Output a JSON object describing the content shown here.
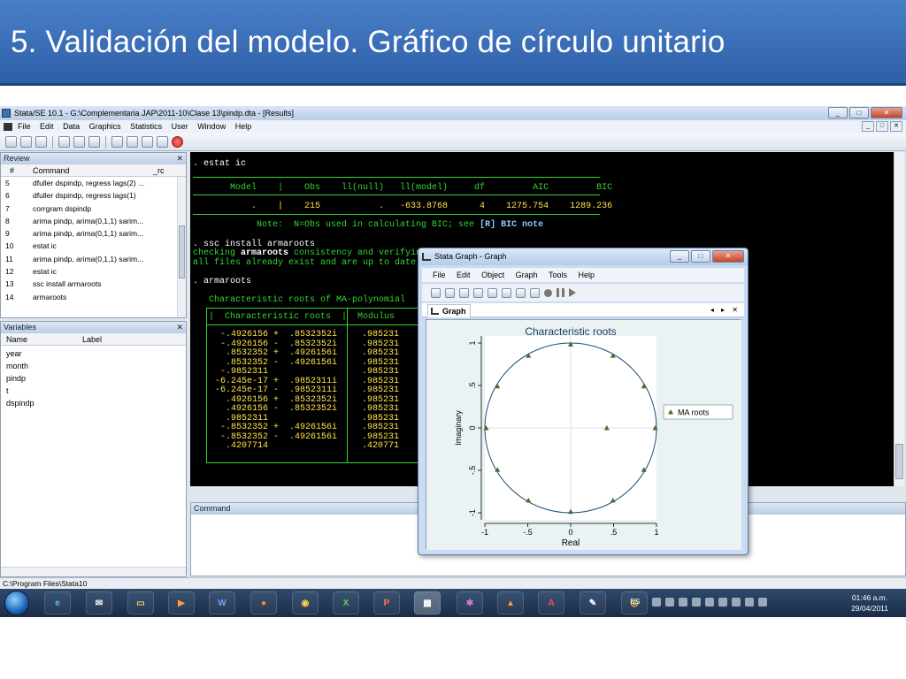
{
  "slide": {
    "title": "5. Validación del modelo. Gráfico de círculo unitario"
  },
  "stata": {
    "window_title": "Stata/SE 10.1 - G:\\Complementaria JAP\\2011-10\\Clase 13\\pindp.dta - [Results]",
    "menu": [
      "File",
      "Edit",
      "Data",
      "Graphics",
      "Statistics",
      "User",
      "Window",
      "Help"
    ],
    "review": {
      "title": "Review",
      "col_hash": "#",
      "col_command": "Command",
      "col_rc": "_rc",
      "rows": [
        {
          "n": "5",
          "cmd": "dfuller dspindp, regress lags(2) ..."
        },
        {
          "n": "6",
          "cmd": "dfuller dspindp, regress lags(1)"
        },
        {
          "n": "7",
          "cmd": "corrgram dspindp"
        },
        {
          "n": "8",
          "cmd": "arima pindp, arima(0,1,1) sarim..."
        },
        {
          "n": "9",
          "cmd": "arima pindp, arima(0,1,1) sarim..."
        },
        {
          "n": "10",
          "cmd": "estat ic"
        },
        {
          "n": "11",
          "cmd": "arima pindp, arima(0,1,1) sarim..."
        },
        {
          "n": "12",
          "cmd": "estat ic"
        },
        {
          "n": "13",
          "cmd": "ssc install armaroots"
        },
        {
          "n": "14",
          "cmd": "armaroots"
        }
      ]
    },
    "variables": {
      "title": "Variables",
      "col_name": "Name",
      "col_label": "Label",
      "items": [
        "year",
        "month",
        "pindp",
        "t",
        "dspindp"
      ]
    },
    "results": {
      "cmd1": ". estat ic",
      "ic_header": "       Model    |    Obs    ll(null)   ll(model)     df         AIC         BIC",
      "ic_row": "           .    |    215           .   -633.8768      4    1275.754    1289.236",
      "ic_note_a": "            Note:  N=Obs used in calculating BIC; see ",
      "ic_note_b": "[R] BIC note",
      "cmd2": ". ssc install armaroots",
      "check_a": "checking ",
      "check_b": "armaroots",
      "check_c": " consistency and verifying",
      "files": "all files already exist and are up to date.",
      "cmd3": ". armaroots",
      "roots_title": "   Characteristic roots of MA-polynomial",
      "roots_header": "   |  Characteristic roots  |  Modulus",
      "roots": [
        [
          "  -.4926156 +  .8532352i",
          " .985231"
        ],
        [
          "  -.4926156 -  .8532352i",
          " .985231"
        ],
        [
          "   .8532352 +  .4926156i",
          " .985231"
        ],
        [
          "   .8532352 -  .4926156i",
          " .985231"
        ],
        [
          "  -.9852311             ",
          " .985231"
        ],
        [
          " -6.245e-17 +  .9852311i",
          " .985231"
        ],
        [
          " -6.245e-17 -  .9852311i",
          " .985231"
        ],
        [
          "   .4926156 +  .8532352i",
          " .985231"
        ],
        [
          "   .4926156 -  .8532352i",
          " .985231"
        ],
        [
          "   .9852311             ",
          " .985231"
        ],
        [
          "  -.8532352 +  .4926156i",
          " .985231"
        ],
        [
          "  -.8532352 -  .4926156i",
          " .985231"
        ],
        [
          "   .4207714             ",
          " .420771"
        ]
      ]
    },
    "command_panel": {
      "title": "Command"
    },
    "status": "C:\\Program Files\\Stata10"
  },
  "graph_window": {
    "title": "Stata Graph - Graph",
    "menu": [
      "File",
      "Edit",
      "Object",
      "Graph",
      "Tools",
      "Help"
    ],
    "tab": "Graph",
    "tab_nav": "◂ ▸ ✕"
  },
  "chart_data": {
    "type": "scatter",
    "title": "Characteristic roots",
    "xlabel": "Real",
    "ylabel": "Imaginary",
    "xlim": [
      -1,
      1
    ],
    "ylim": [
      -1,
      1
    ],
    "xticks": [
      "-1",
      "-.5",
      "0",
      ".5",
      "1"
    ],
    "yticks": [
      "1",
      ".5",
      "0",
      "-.5",
      "-1"
    ],
    "unit_circle": true,
    "grid": true,
    "legend_position": "right",
    "series": [
      {
        "name": "MA roots",
        "color": "#4a6a2a",
        "points": [
          [
            -0.4926156,
            0.8532352
          ],
          [
            -0.4926156,
            -0.8532352
          ],
          [
            0.8532352,
            0.4926156
          ],
          [
            0.8532352,
            -0.4926156
          ],
          [
            -0.9852311,
            0
          ],
          [
            0,
            0.9852311
          ],
          [
            0,
            -0.9852311
          ],
          [
            0.4926156,
            0.8532352
          ],
          [
            0.4926156,
            -0.8532352
          ],
          [
            0.9852311,
            0
          ],
          [
            -0.8532352,
            0.4926156
          ],
          [
            -0.8532352,
            -0.4926156
          ],
          [
            0.4207714,
            0
          ]
        ]
      }
    ]
  },
  "taskbar": {
    "lang": "ES",
    "time": "01:46 a.m.",
    "date": "29/04/2011"
  },
  "colors": {
    "green": "#35d435",
    "yellow": "#ffe24a",
    "slide_blue": "#2d5fa8"
  }
}
